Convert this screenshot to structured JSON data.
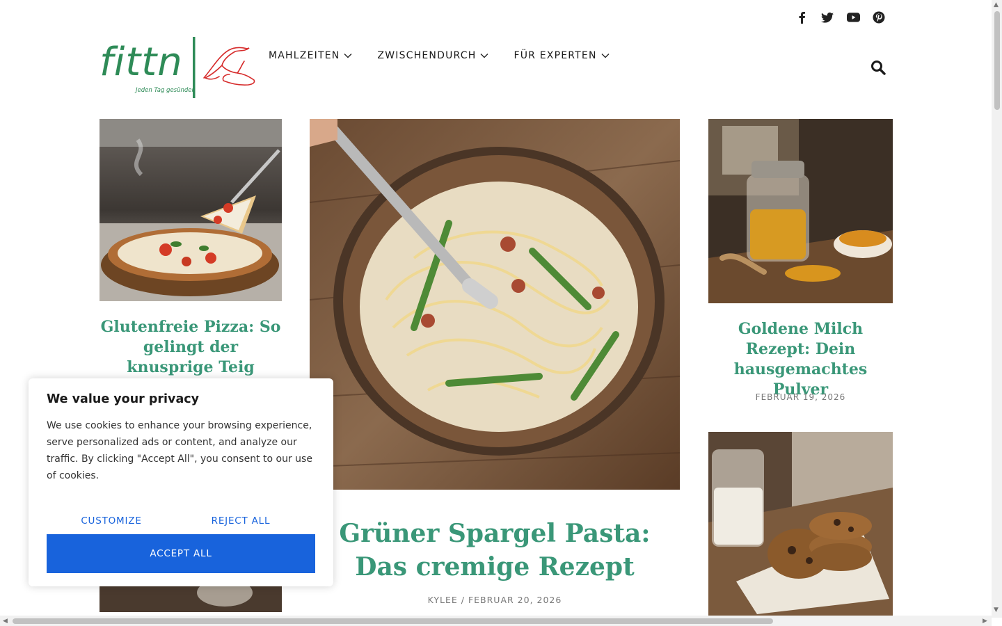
{
  "social": {
    "icons": [
      "facebook-icon",
      "twitter-icon",
      "youtube-icon",
      "pinterest-icon"
    ]
  },
  "logo": {
    "text": "fittn",
    "tagline": "Jeden Tag gesünder",
    "colors": {
      "text": "#2e8b57",
      "figure": "#d62b2b"
    }
  },
  "nav": {
    "items": [
      {
        "label": "MAHLZEITEN"
      },
      {
        "label": "ZWISCHENDURCH"
      },
      {
        "label": "FÜR EXPERTEN"
      }
    ]
  },
  "posts": {
    "left": {
      "title": "Glutenfreie Pizza: So gelingt der knusprige Teig"
    },
    "featured": {
      "title": "Grüner Spargel Pasta: Das cremige Rezept",
      "meta": "KYLEE / FEBRUAR 20, 2026"
    },
    "right_top": {
      "title": "Goldene Milch Rezept: Dein hausgemachtes Pulver",
      "meta": "FEBRUAR 19, 2026"
    }
  },
  "cookie": {
    "title": "We value your privacy",
    "text": "We use cookies to enhance your browsing experience, serve personalized ads or content, and analyze our traffic. By clicking \"Accept All\", you consent to our use of cookies.",
    "customize": "CUSTOMIZE",
    "reject": "REJECT ALL",
    "accept": "ACCEPT ALL"
  },
  "colors": {
    "accent_green": "#3a9778",
    "cookie_blue": "#1863dc"
  }
}
